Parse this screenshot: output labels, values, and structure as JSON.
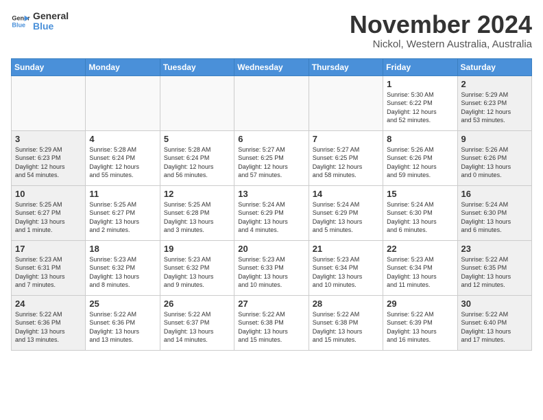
{
  "logo": {
    "line1": "General",
    "line2": "Blue"
  },
  "header": {
    "month": "November 2024",
    "location": "Nickol, Western Australia, Australia"
  },
  "weekdays": [
    "Sunday",
    "Monday",
    "Tuesday",
    "Wednesday",
    "Thursday",
    "Friday",
    "Saturday"
  ],
  "weeks": [
    [
      {
        "day": "",
        "info": ""
      },
      {
        "day": "",
        "info": ""
      },
      {
        "day": "",
        "info": ""
      },
      {
        "day": "",
        "info": ""
      },
      {
        "day": "",
        "info": ""
      },
      {
        "day": "1",
        "info": "Sunrise: 5:30 AM\nSunset: 6:22 PM\nDaylight: 12 hours\nand 52 minutes."
      },
      {
        "day": "2",
        "info": "Sunrise: 5:29 AM\nSunset: 6:23 PM\nDaylight: 12 hours\nand 53 minutes."
      }
    ],
    [
      {
        "day": "3",
        "info": "Sunrise: 5:29 AM\nSunset: 6:23 PM\nDaylight: 12 hours\nand 54 minutes."
      },
      {
        "day": "4",
        "info": "Sunrise: 5:28 AM\nSunset: 6:24 PM\nDaylight: 12 hours\nand 55 minutes."
      },
      {
        "day": "5",
        "info": "Sunrise: 5:28 AM\nSunset: 6:24 PM\nDaylight: 12 hours\nand 56 minutes."
      },
      {
        "day": "6",
        "info": "Sunrise: 5:27 AM\nSunset: 6:25 PM\nDaylight: 12 hours\nand 57 minutes."
      },
      {
        "day": "7",
        "info": "Sunrise: 5:27 AM\nSunset: 6:25 PM\nDaylight: 12 hours\nand 58 minutes."
      },
      {
        "day": "8",
        "info": "Sunrise: 5:26 AM\nSunset: 6:26 PM\nDaylight: 12 hours\nand 59 minutes."
      },
      {
        "day": "9",
        "info": "Sunrise: 5:26 AM\nSunset: 6:26 PM\nDaylight: 13 hours\nand 0 minutes."
      }
    ],
    [
      {
        "day": "10",
        "info": "Sunrise: 5:25 AM\nSunset: 6:27 PM\nDaylight: 13 hours\nand 1 minute."
      },
      {
        "day": "11",
        "info": "Sunrise: 5:25 AM\nSunset: 6:27 PM\nDaylight: 13 hours\nand 2 minutes."
      },
      {
        "day": "12",
        "info": "Sunrise: 5:25 AM\nSunset: 6:28 PM\nDaylight: 13 hours\nand 3 minutes."
      },
      {
        "day": "13",
        "info": "Sunrise: 5:24 AM\nSunset: 6:29 PM\nDaylight: 13 hours\nand 4 minutes."
      },
      {
        "day": "14",
        "info": "Sunrise: 5:24 AM\nSunset: 6:29 PM\nDaylight: 13 hours\nand 5 minutes."
      },
      {
        "day": "15",
        "info": "Sunrise: 5:24 AM\nSunset: 6:30 PM\nDaylight: 13 hours\nand 6 minutes."
      },
      {
        "day": "16",
        "info": "Sunrise: 5:24 AM\nSunset: 6:30 PM\nDaylight: 13 hours\nand 6 minutes."
      }
    ],
    [
      {
        "day": "17",
        "info": "Sunrise: 5:23 AM\nSunset: 6:31 PM\nDaylight: 13 hours\nand 7 minutes."
      },
      {
        "day": "18",
        "info": "Sunrise: 5:23 AM\nSunset: 6:32 PM\nDaylight: 13 hours\nand 8 minutes."
      },
      {
        "day": "19",
        "info": "Sunrise: 5:23 AM\nSunset: 6:32 PM\nDaylight: 13 hours\nand 9 minutes."
      },
      {
        "day": "20",
        "info": "Sunrise: 5:23 AM\nSunset: 6:33 PM\nDaylight: 13 hours\nand 10 minutes."
      },
      {
        "day": "21",
        "info": "Sunrise: 5:23 AM\nSunset: 6:34 PM\nDaylight: 13 hours\nand 10 minutes."
      },
      {
        "day": "22",
        "info": "Sunrise: 5:23 AM\nSunset: 6:34 PM\nDaylight: 13 hours\nand 11 minutes."
      },
      {
        "day": "23",
        "info": "Sunrise: 5:22 AM\nSunset: 6:35 PM\nDaylight: 13 hours\nand 12 minutes."
      }
    ],
    [
      {
        "day": "24",
        "info": "Sunrise: 5:22 AM\nSunset: 6:36 PM\nDaylight: 13 hours\nand 13 minutes."
      },
      {
        "day": "25",
        "info": "Sunrise: 5:22 AM\nSunset: 6:36 PM\nDaylight: 13 hours\nand 13 minutes."
      },
      {
        "day": "26",
        "info": "Sunrise: 5:22 AM\nSunset: 6:37 PM\nDaylight: 13 hours\nand 14 minutes."
      },
      {
        "day": "27",
        "info": "Sunrise: 5:22 AM\nSunset: 6:38 PM\nDaylight: 13 hours\nand 15 minutes."
      },
      {
        "day": "28",
        "info": "Sunrise: 5:22 AM\nSunset: 6:38 PM\nDaylight: 13 hours\nand 15 minutes."
      },
      {
        "day": "29",
        "info": "Sunrise: 5:22 AM\nSunset: 6:39 PM\nDaylight: 13 hours\nand 16 minutes."
      },
      {
        "day": "30",
        "info": "Sunrise: 5:22 AM\nSunset: 6:40 PM\nDaylight: 13 hours\nand 17 minutes."
      }
    ]
  ]
}
